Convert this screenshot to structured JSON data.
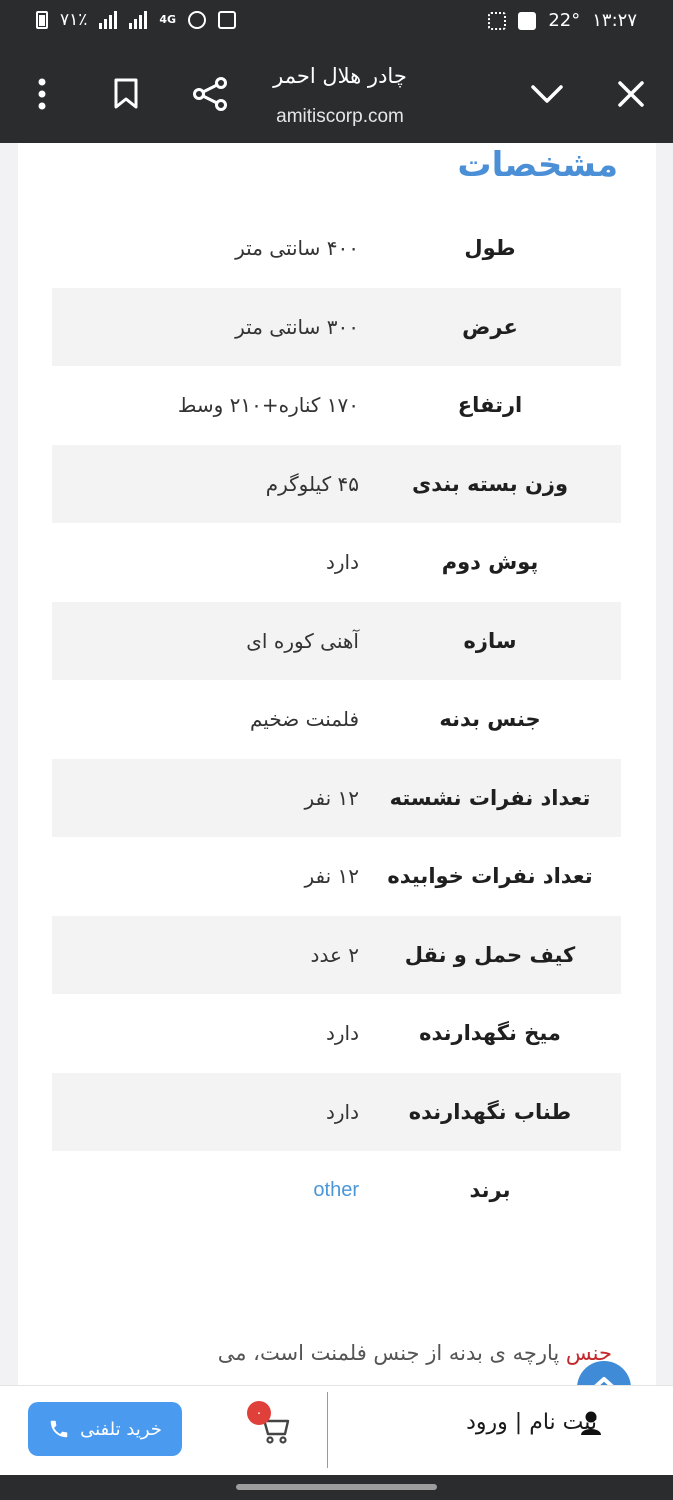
{
  "status_bar": {
    "battery": "٧١٪",
    "network": "4G",
    "temperature": "22°",
    "time": "۱۳:۲۷"
  },
  "browser": {
    "page_title": "چادر هلال احمر",
    "url": "amitiscorp.com",
    "icons": {
      "close": "close-icon",
      "collapse": "chevron-down-icon",
      "share": "share-icon",
      "bookmark": "bookmark-icon",
      "menu": "more-vert-icon"
    }
  },
  "page": {
    "section_title": "مشخصات",
    "specs": [
      {
        "key": "طول",
        "value": "۴۰۰ سانتی متر"
      },
      {
        "key": "عرض",
        "value": "۳۰۰ سانتی متر"
      },
      {
        "key": "ارتفاع",
        "value": "۱۷۰ کناره+۲۱۰ وسط"
      },
      {
        "key": "وزن بسته بندی",
        "value": "۴۵ کیلوگرم"
      },
      {
        "key": "پوش دوم",
        "value": "دارد"
      },
      {
        "key": "سازه",
        "value": "آهنی کوره ای"
      },
      {
        "key": "جنس بدنه",
        "value": "فلمنت ضخیم"
      },
      {
        "key": "تعداد نفرات نشسته",
        "value": "۱۲ نفر"
      },
      {
        "key": "تعداد نفرات خوابیده",
        "value": "۱۲ نفر"
      },
      {
        "key": "کیف حمل و نقل",
        "value": "۲ عدد"
      },
      {
        "key": "میخ نگهدارنده",
        "value": "دارد"
      },
      {
        "key": "طناب نگهدارنده",
        "value": "دارد"
      },
      {
        "key": "برند",
        "value": "other"
      }
    ],
    "description": {
      "highlight": "جنس",
      "text": " پارچه ی بدنه از جنس فلمنت است، می"
    }
  },
  "bottom_bar": {
    "call_label": "خرید تلفنی",
    "cart_count": "۰",
    "login_label": "ثبت نام | ورود"
  },
  "colors": {
    "accent": "#4b8fd6",
    "call_button": "#4a9af0",
    "badge": "#e0403a",
    "highlight": "#c4282d",
    "dark_bar": "#2b2c2e"
  }
}
